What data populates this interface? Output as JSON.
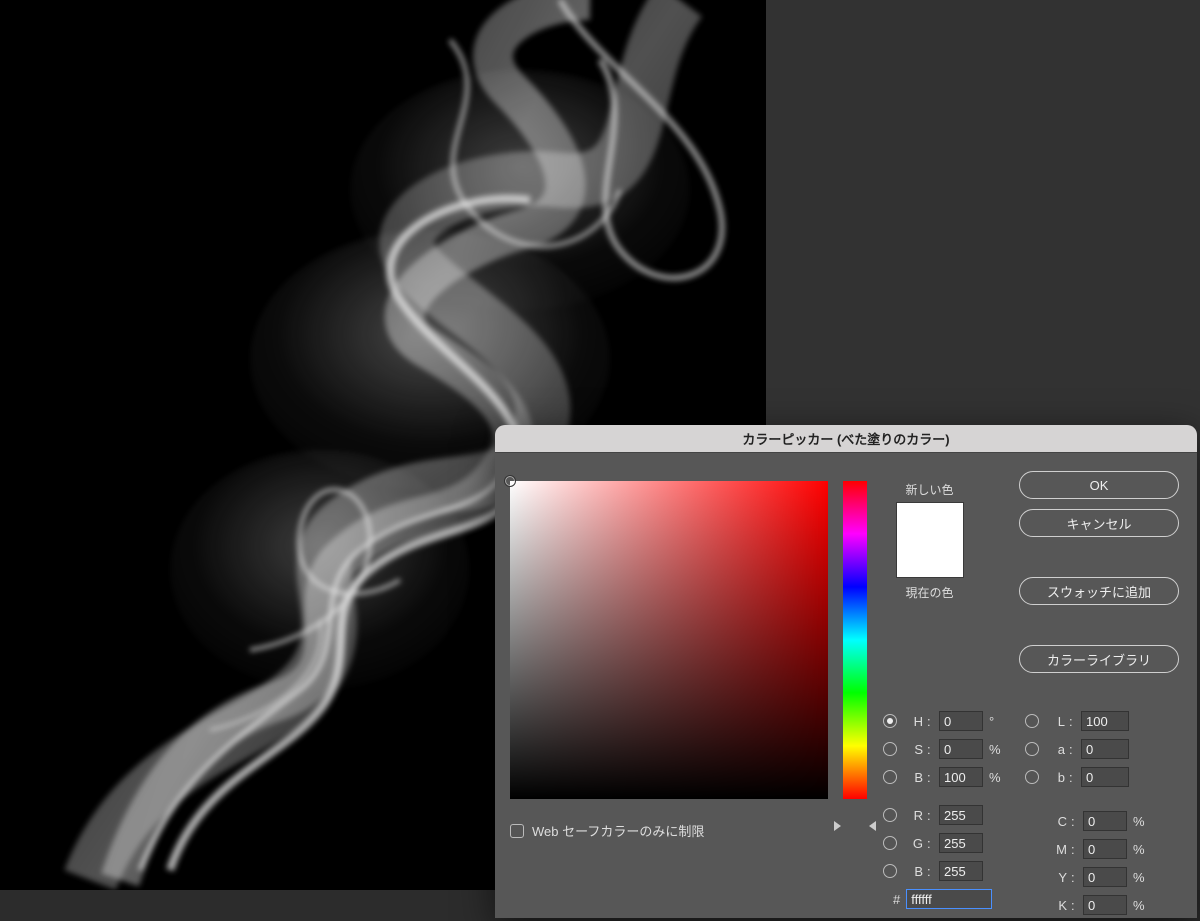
{
  "dialog": {
    "title": "カラーピッカー (べた塗りのカラー)",
    "new_color_label": "新しい色",
    "current_color_label": "現在の色",
    "new_color_hex": "#ffffff",
    "current_color_hex": "#ffffff",
    "buttons": {
      "ok": "OK",
      "cancel": "キャンセル",
      "add_swatch": "スウォッチに追加",
      "library": "カラーライブラリ"
    },
    "hsb": {
      "h": {
        "label": "H",
        "value": "0",
        "unit": "°"
      },
      "s": {
        "label": "S",
        "value": "0",
        "unit": "%"
      },
      "b": {
        "label": "B",
        "value": "100",
        "unit": "%"
      }
    },
    "lab": {
      "l": {
        "label": "L",
        "value": "100"
      },
      "a": {
        "label": "a",
        "value": "0"
      },
      "b": {
        "label": "b",
        "value": "0"
      }
    },
    "rgb": {
      "r": {
        "label": "R",
        "value": "255"
      },
      "g": {
        "label": "G",
        "value": "255"
      },
      "b": {
        "label": "B",
        "value": "255"
      }
    },
    "cmyk": {
      "c": {
        "label": "C",
        "value": "0",
        "unit": "%"
      },
      "m": {
        "label": "M",
        "value": "0",
        "unit": "%"
      },
      "y": {
        "label": "Y",
        "value": "0",
        "unit": "%"
      },
      "k": {
        "label": "K",
        "value": "0",
        "unit": "%"
      }
    },
    "hex": {
      "prefix": "#",
      "value": "ffffff"
    },
    "websafe_label": "Web セーフカラーのみに制限",
    "selected_radio": "H"
  }
}
